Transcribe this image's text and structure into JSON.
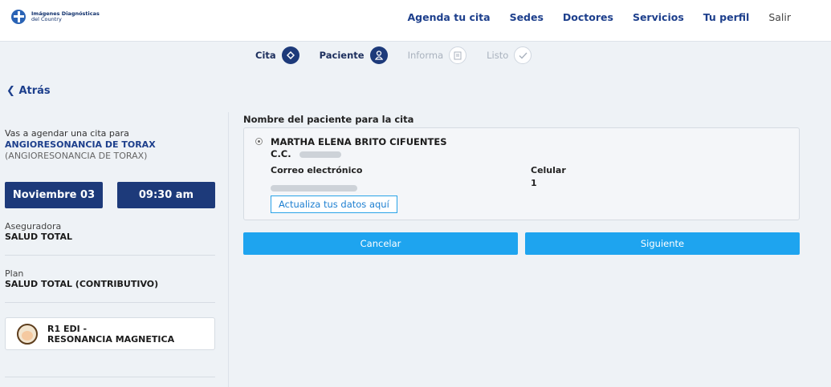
{
  "header": {
    "logo_line1": "Imágenes Diagnósticas",
    "logo_line2": "del Country",
    "nav": [
      "Agenda tu cita",
      "Sedes",
      "Doctores",
      "Servicios",
      "Tu perfil"
    ],
    "exit": "Salir"
  },
  "steps": [
    {
      "label": "Cita",
      "icon": "location-icon",
      "active": true
    },
    {
      "label": "Paciente",
      "icon": "person-icon",
      "active": true
    },
    {
      "label": "Informa",
      "icon": "clipboard-icon",
      "active": false
    },
    {
      "label": "Listo",
      "icon": "check-icon",
      "active": false
    }
  ],
  "back_label": "Atrás",
  "summary": {
    "intro": "Vas a agendar una cita para",
    "study": "ANGIORESONANCIA DE TORAX",
    "study_sub": "(ANGIORESONANCIA DE TORAX)",
    "date": "Noviembre 03",
    "time": "09:30 am",
    "insurer_label": "Aseguradora",
    "insurer_value": "SALUD TOTAL",
    "plan_label": "Plan",
    "plan_value": "SALUD TOTAL (CONTRIBUTIVO)",
    "doctor_line1": "R1 EDI -",
    "doctor_line2": "RESONANCIA MAGNETICA"
  },
  "patient": {
    "section_title": "Nombre del paciente para la cita",
    "name": "MARTHA ELENA BRITO CIFUENTES",
    "doc_prefix": "C.C.",
    "email_label": "Correo electrónico",
    "phone_label": "Celular",
    "phone_value": "1",
    "update_label": "Actualiza tus datos aquí"
  },
  "actions": {
    "cancel": "Cancelar",
    "next": "Siguiente"
  },
  "colors": {
    "primary_dark": "#1d3a7a",
    "accent": "#1ea4ef"
  }
}
